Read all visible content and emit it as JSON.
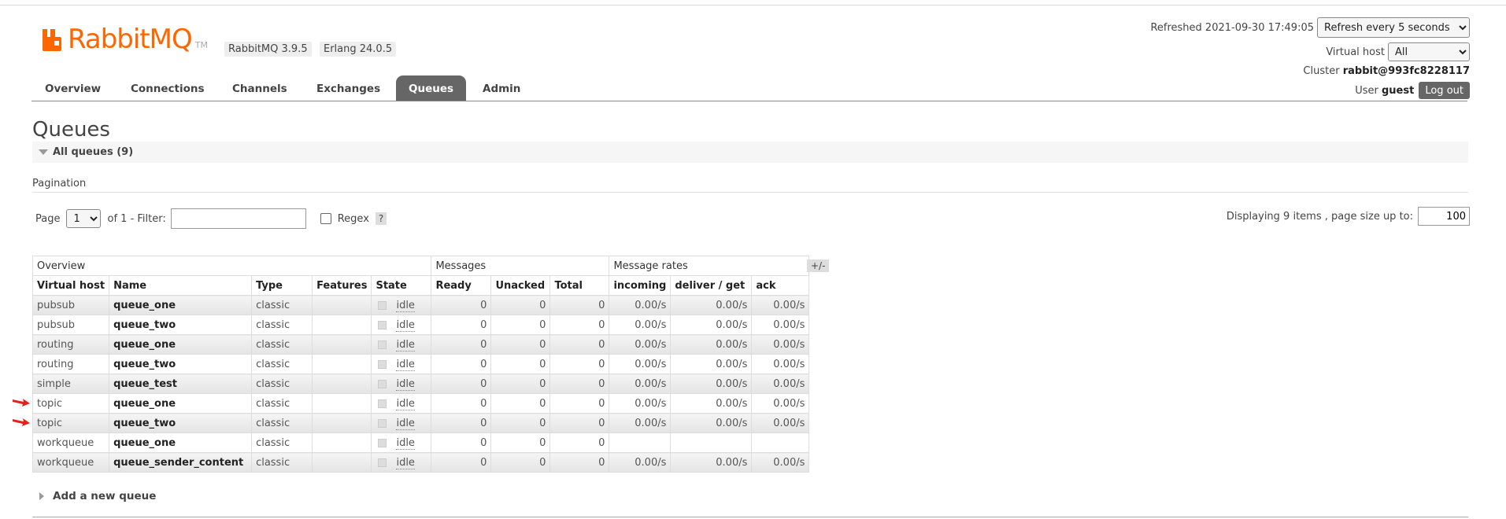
{
  "logo": {
    "text": "RabbitMQ",
    "tm": "TM"
  },
  "versions": {
    "rabbitmq": "RabbitMQ 3.9.5",
    "erlang": "Erlang 24.0.5"
  },
  "header": {
    "refreshed_label": "Refreshed 2021-09-30 17:49:05",
    "refresh_option": "Refresh every 5 seconds",
    "vhost_label": "Virtual host",
    "vhost_value": "All",
    "cluster_label": "Cluster",
    "cluster_value": "rabbit@993fc8228117",
    "user_label": "User",
    "user_value": "guest",
    "logout": "Log out"
  },
  "nav": {
    "overview": "Overview",
    "connections": "Connections",
    "channels": "Channels",
    "exchanges": "Exchanges",
    "queues": "Queues",
    "admin": "Admin"
  },
  "page_title": "Queues",
  "section": {
    "all_queues": "All queues (9)"
  },
  "pagination": {
    "label": "Pagination",
    "page_label": "Page",
    "page_value": "1",
    "of_label": "of 1",
    "filter_label": "- Filter:",
    "filter_value": "",
    "regex_label": "Regex",
    "help": "?",
    "display_info": "Displaying 9 items , page size up to:",
    "page_size": "100"
  },
  "table": {
    "groups": {
      "overview": "Overview",
      "messages": "Messages",
      "rates": "Message rates"
    },
    "plus_minus": "+/-",
    "columns": {
      "vhost": "Virtual host",
      "name": "Name",
      "type": "Type",
      "features": "Features",
      "state": "State",
      "ready": "Ready",
      "unacked": "Unacked",
      "total": "Total",
      "incoming": "incoming",
      "deliver": "deliver / get",
      "ack": "ack"
    },
    "rows": [
      {
        "vhost": "pubsub",
        "name": "queue_one",
        "type": "classic",
        "state": "idle",
        "ready": "0",
        "unacked": "0",
        "total": "0",
        "incoming": "0.00/s",
        "deliver": "0.00/s",
        "ack": "0.00/s"
      },
      {
        "vhost": "pubsub",
        "name": "queue_two",
        "type": "classic",
        "state": "idle",
        "ready": "0",
        "unacked": "0",
        "total": "0",
        "incoming": "0.00/s",
        "deliver": "0.00/s",
        "ack": "0.00/s"
      },
      {
        "vhost": "routing",
        "name": "queue_one",
        "type": "classic",
        "state": "idle",
        "ready": "0",
        "unacked": "0",
        "total": "0",
        "incoming": "0.00/s",
        "deliver": "0.00/s",
        "ack": "0.00/s"
      },
      {
        "vhost": "routing",
        "name": "queue_two",
        "type": "classic",
        "state": "idle",
        "ready": "0",
        "unacked": "0",
        "total": "0",
        "incoming": "0.00/s",
        "deliver": "0.00/s",
        "ack": "0.00/s"
      },
      {
        "vhost": "simple",
        "name": "queue_test",
        "type": "classic",
        "state": "idle",
        "ready": "0",
        "unacked": "0",
        "total": "0",
        "incoming": "0.00/s",
        "deliver": "0.00/s",
        "ack": "0.00/s"
      },
      {
        "vhost": "topic",
        "name": "queue_one",
        "type": "classic",
        "state": "idle",
        "ready": "0",
        "unacked": "0",
        "total": "0",
        "incoming": "0.00/s",
        "deliver": "0.00/s",
        "ack": "0.00/s"
      },
      {
        "vhost": "topic",
        "name": "queue_two",
        "type": "classic",
        "state": "idle",
        "ready": "0",
        "unacked": "0",
        "total": "0",
        "incoming": "0.00/s",
        "deliver": "0.00/s",
        "ack": "0.00/s"
      },
      {
        "vhost": "workqueue",
        "name": "queue_one",
        "type": "classic",
        "state": "idle",
        "ready": "0",
        "unacked": "0",
        "total": "0",
        "incoming": "",
        "deliver": "",
        "ack": ""
      },
      {
        "vhost": "workqueue",
        "name": "queue_sender_content",
        "type": "classic",
        "state": "idle",
        "ready": "0",
        "unacked": "0",
        "total": "0",
        "incoming": "0.00/s",
        "deliver": "0.00/s",
        "ack": "0.00/s"
      }
    ]
  },
  "add_queue": "Add a new queue",
  "colors": {
    "brand": "#ff6600",
    "active_tab": "#666666",
    "arrow": "#e8201a"
  }
}
